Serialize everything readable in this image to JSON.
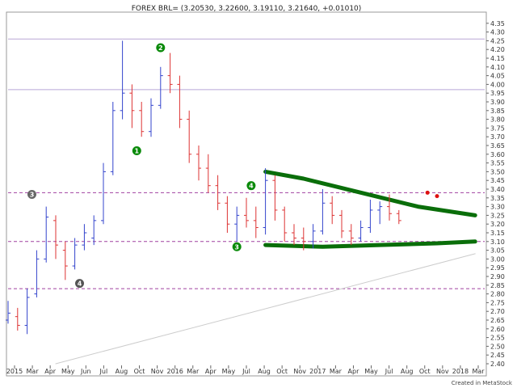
{
  "chart_data": {
    "type": "ohlc",
    "title": "FOREX BRL= (3.20530, 3.22600, 3.19110, 3.21640, +0.01010)",
    "credit": "Created in MetaStock",
    "ylim": [
      2.4,
      4.4
    ],
    "yticks": [
      2.4,
      2.45,
      2.5,
      2.55,
      2.6,
      2.65,
      2.7,
      2.75,
      2.8,
      2.85,
      2.9,
      2.95,
      3.0,
      3.05,
      3.1,
      3.15,
      3.2,
      3.25,
      3.3,
      3.35,
      3.4,
      3.45,
      3.5,
      3.55,
      3.6,
      3.65,
      3.7,
      3.75,
      3.8,
      3.85,
      3.9,
      3.95,
      4.0,
      4.05,
      4.1,
      4.15,
      4.2,
      4.25,
      4.3,
      4.35
    ],
    "xticks": [
      "2015",
      "Mar",
      "Apr",
      "May",
      "Jun",
      "Jul",
      "Aug",
      "Oct",
      "Nov",
      "2016",
      "Mar",
      "Apr",
      "May",
      "Jul",
      "Aug",
      "Oct",
      "Nov",
      "2017",
      "Mar",
      "Apr",
      "May",
      "Jul",
      "Aug",
      "Oct",
      "Nov",
      "2018",
      "Mar"
    ],
    "colors": {
      "up": "#3344cc",
      "down": "#dd3333",
      "trend": "#0a6e0a"
    },
    "hlines": [
      {
        "y": 4.26,
        "style": "solid",
        "color": "#b9a7d6"
      },
      {
        "y": 3.97,
        "style": "solid",
        "color": "#b9a7d6"
      },
      {
        "y": 3.38,
        "style": "dashed",
        "color": "#a040a0"
      },
      {
        "y": 3.1,
        "style": "dashed",
        "color": "#a040a0"
      },
      {
        "y": 2.83,
        "style": "dashed",
        "color": "#a040a0"
      }
    ],
    "series": [
      {
        "t": 0.0,
        "o": 2.65,
        "h": 2.76,
        "l": 2.63,
        "c": 2.69
      },
      {
        "t": 0.02,
        "o": 2.67,
        "h": 2.72,
        "l": 2.59,
        "c": 2.62
      },
      {
        "t": 0.04,
        "o": 2.62,
        "h": 2.83,
        "l": 2.57,
        "c": 2.78
      },
      {
        "t": 0.06,
        "o": 2.8,
        "h": 3.05,
        "l": 2.78,
        "c": 3.0
      },
      {
        "t": 0.08,
        "o": 3.0,
        "h": 3.3,
        "l": 2.98,
        "c": 3.24
      },
      {
        "t": 0.1,
        "o": 3.22,
        "h": 3.25,
        "l": 3.0,
        "c": 3.08
      },
      {
        "t": 0.12,
        "o": 3.05,
        "h": 3.1,
        "l": 2.88,
        "c": 2.96
      },
      {
        "t": 0.14,
        "o": 2.96,
        "h": 3.12,
        "l": 2.94,
        "c": 3.08
      },
      {
        "t": 0.16,
        "o": 3.08,
        "h": 3.2,
        "l": 3.05,
        "c": 3.15
      },
      {
        "t": 0.18,
        "o": 3.12,
        "h": 3.25,
        "l": 3.08,
        "c": 3.22
      },
      {
        "t": 0.2,
        "o": 3.22,
        "h": 3.55,
        "l": 3.2,
        "c": 3.5
      },
      {
        "t": 0.22,
        "o": 3.5,
        "h": 3.9,
        "l": 3.48,
        "c": 3.85
      },
      {
        "t": 0.24,
        "o": 3.85,
        "h": 4.25,
        "l": 3.8,
        "c": 3.95
      },
      {
        "t": 0.26,
        "o": 3.95,
        "h": 4.0,
        "l": 3.75,
        "c": 3.85
      },
      {
        "t": 0.28,
        "o": 3.85,
        "h": 3.9,
        "l": 3.7,
        "c": 3.73
      },
      {
        "t": 0.3,
        "o": 3.73,
        "h": 3.92,
        "l": 3.7,
        "c": 3.88
      },
      {
        "t": 0.32,
        "o": 3.88,
        "h": 4.1,
        "l": 3.86,
        "c": 4.05
      },
      {
        "t": 0.34,
        "o": 4.05,
        "h": 4.18,
        "l": 3.95,
        "c": 4.0
      },
      {
        "t": 0.36,
        "o": 4.0,
        "h": 4.05,
        "l": 3.75,
        "c": 3.8
      },
      {
        "t": 0.38,
        "o": 3.8,
        "h": 3.85,
        "l": 3.55,
        "c": 3.6
      },
      {
        "t": 0.4,
        "o": 3.6,
        "h": 3.65,
        "l": 3.45,
        "c": 3.52
      },
      {
        "t": 0.42,
        "o": 3.52,
        "h": 3.6,
        "l": 3.38,
        "c": 3.42
      },
      {
        "t": 0.44,
        "o": 3.42,
        "h": 3.48,
        "l": 3.28,
        "c": 3.32
      },
      {
        "t": 0.46,
        "o": 3.32,
        "h": 3.36,
        "l": 3.15,
        "c": 3.2
      },
      {
        "t": 0.48,
        "o": 3.2,
        "h": 3.3,
        "l": 3.1,
        "c": 3.25
      },
      {
        "t": 0.5,
        "o": 3.25,
        "h": 3.35,
        "l": 3.18,
        "c": 3.22
      },
      {
        "t": 0.52,
        "o": 3.22,
        "h": 3.3,
        "l": 3.12,
        "c": 3.18
      },
      {
        "t": 0.54,
        "o": 3.18,
        "h": 3.52,
        "l": 3.14,
        "c": 3.45
      },
      {
        "t": 0.56,
        "o": 3.45,
        "h": 3.48,
        "l": 3.22,
        "c": 3.28
      },
      {
        "t": 0.58,
        "o": 3.28,
        "h": 3.3,
        "l": 3.1,
        "c": 3.15
      },
      {
        "t": 0.6,
        "o": 3.15,
        "h": 3.2,
        "l": 3.08,
        "c": 3.12
      },
      {
        "t": 0.62,
        "o": 3.12,
        "h": 3.18,
        "l": 3.05,
        "c": 3.1
      },
      {
        "t": 0.64,
        "o": 3.1,
        "h": 3.2,
        "l": 3.06,
        "c": 3.16
      },
      {
        "t": 0.66,
        "o": 3.16,
        "h": 3.4,
        "l": 3.14,
        "c": 3.32
      },
      {
        "t": 0.68,
        "o": 3.32,
        "h": 3.36,
        "l": 3.2,
        "c": 3.25
      },
      {
        "t": 0.7,
        "o": 3.25,
        "h": 3.28,
        "l": 3.12,
        "c": 3.16
      },
      {
        "t": 0.72,
        "o": 3.16,
        "h": 3.2,
        "l": 3.08,
        "c": 3.12
      },
      {
        "t": 0.74,
        "o": 3.12,
        "h": 3.22,
        "l": 3.1,
        "c": 3.18
      },
      {
        "t": 0.76,
        "o": 3.18,
        "h": 3.34,
        "l": 3.15,
        "c": 3.28
      },
      {
        "t": 0.78,
        "o": 3.28,
        "h": 3.33,
        "l": 3.2,
        "c": 3.3
      },
      {
        "t": 0.8,
        "o": 3.3,
        "h": 3.37,
        "l": 3.22,
        "c": 3.26
      },
      {
        "t": 0.82,
        "o": 3.26,
        "h": 3.28,
        "l": 3.2,
        "c": 3.22
      }
    ],
    "trendlines": [
      {
        "points": [
          [
            0.54,
            3.5
          ],
          [
            0.62,
            3.46
          ],
          [
            0.74,
            3.38
          ],
          [
            0.86,
            3.3
          ],
          [
            0.98,
            3.25
          ]
        ],
        "width": 5
      },
      {
        "points": [
          [
            0.54,
            3.08
          ],
          [
            0.66,
            3.07
          ],
          [
            0.78,
            3.08
          ],
          [
            0.9,
            3.09
          ],
          [
            0.98,
            3.1
          ]
        ],
        "width": 5
      },
      {
        "points": [
          [
            0.1,
            2.4
          ],
          [
            0.98,
            3.03
          ]
        ],
        "width": 1,
        "color": "#cccccc"
      }
    ],
    "wave_markers": [
      {
        "label": "1",
        "t": 0.27,
        "y": 3.62,
        "color": "#0a8a0a"
      },
      {
        "label": "2",
        "t": 0.32,
        "y": 4.21,
        "color": "#0a8a0a"
      },
      {
        "label": "3",
        "t": 0.05,
        "y": 3.37,
        "color": "#666666"
      },
      {
        "label": "4",
        "t": 0.15,
        "y": 2.86,
        "color": "#555555"
      },
      {
        "label": "3",
        "t": 0.48,
        "y": 3.07,
        "color": "#0a8a0a"
      },
      {
        "label": "4",
        "t": 0.51,
        "y": 3.42,
        "color": "#0a8a0a"
      }
    ],
    "red_dots": [
      {
        "t": 0.88,
        "y": 3.38
      },
      {
        "t": 0.9,
        "y": 3.36
      }
    ]
  }
}
